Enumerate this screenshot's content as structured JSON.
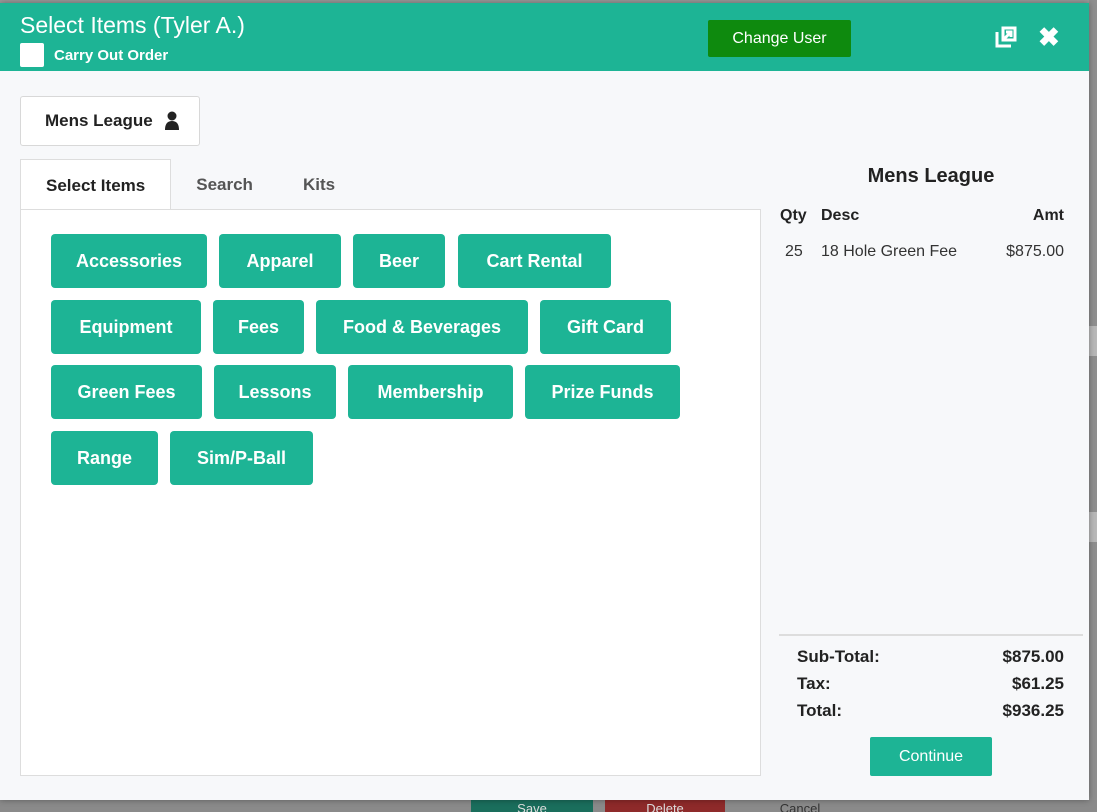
{
  "background": {
    "save_label": "Save",
    "delete_label": "Delete",
    "cancel_label": "Cancel"
  },
  "header": {
    "title": "Select Items (Tyler A.)",
    "carry_out_label": "Carry Out Order",
    "carry_out_checked": false,
    "change_user_label": "Change User",
    "expand_icon": "expand-icon",
    "close_icon": "close-icon"
  },
  "customer_chip": {
    "label": "Mens League",
    "icon": "user-icon"
  },
  "tabs": [
    {
      "label": "Select Items",
      "active": true
    },
    {
      "label": "Search",
      "active": false
    },
    {
      "label": "Kits",
      "active": false
    }
  ],
  "categories": [
    "Accessories",
    "Apparel",
    "Beer",
    "Cart Rental",
    "Equipment",
    "Fees",
    "Food & Beverages",
    "Gift Card",
    "Green Fees",
    "Lessons",
    "Membership",
    "Prize Funds",
    "Range",
    "Sim/P-Ball"
  ],
  "order": {
    "title": "Mens League",
    "columns": {
      "qty": "Qty",
      "desc": "Desc",
      "amt": "Amt"
    },
    "rows": [
      {
        "qty": "25",
        "desc": "18 Hole Green Fee",
        "amt": "$875.00"
      }
    ],
    "subtotal_label": "Sub-Total:",
    "subtotal_value": "$875.00",
    "tax_label": "Tax:",
    "tax_value": "$61.25",
    "total_label": "Total:",
    "total_value": "$936.25",
    "continue_label": "Continue"
  },
  "colors": {
    "accent": "#1db495",
    "change_user": "#0e8a0e"
  }
}
